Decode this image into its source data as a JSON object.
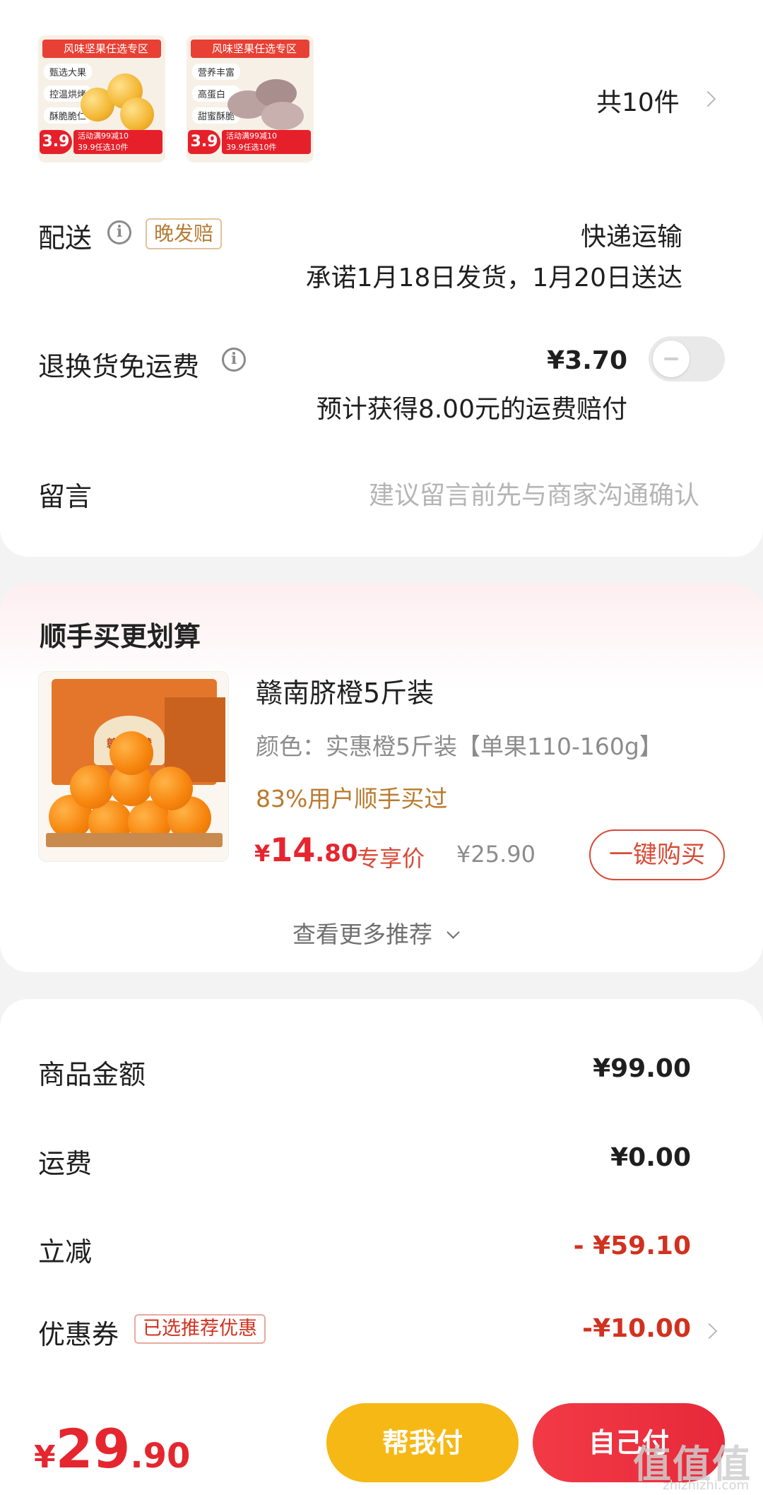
{
  "order": {
    "thumbs": [
      {
        "banner": "风味坚果任选专区",
        "tags": [
          "甄选大果",
          "控温烘烤",
          "酥脆脆仁"
        ],
        "price": "3.9",
        "promo_line1": "活动满99减10",
        "promo_line2": "39.9任选10件"
      },
      {
        "banner": "风味坚果任选专区",
        "tags": [
          "营养丰富",
          "高蛋白",
          "甜蜜酥脆"
        ],
        "price": "3.9",
        "promo_line1": "活动满99减10",
        "promo_line2": "39.9任选10件"
      }
    ],
    "item_count": "共10件",
    "delivery": {
      "label": "配送",
      "badge": "晚发赔",
      "method": "快递运输",
      "promise": "承诺1月18日发货，1月20日送达"
    },
    "return_shipping": {
      "label": "退换货免运费",
      "price": "¥3.70",
      "note": "预计获得8.00元的运费赔付",
      "enabled": false
    },
    "message": {
      "label": "留言",
      "placeholder": "建议留言前先与商家沟通确认"
    }
  },
  "upsell": {
    "title": "顺手买更划算",
    "product": {
      "image_text": "赣南脐橙",
      "name": "赣南脐橙5斤装",
      "spec": "颜色：实惠橙5斤装【单果110-160g】",
      "social_proof": "83%用户顺手买过",
      "price_symbol": "¥",
      "price_int": "14",
      "price_dec": ".80",
      "price_tag": "专享价",
      "original_price": "¥25.90",
      "buy_label": "一键购买"
    },
    "more_label": "查看更多推荐"
  },
  "summary": {
    "rows": [
      {
        "label": "商品金额",
        "value": "¥99.00"
      },
      {
        "label": "运费",
        "value": "¥0.00"
      },
      {
        "label": "立减",
        "value": "- ¥59.10"
      },
      {
        "label": "优惠券",
        "badge": "已选推荐优惠",
        "value": "-¥10.00"
      }
    ]
  },
  "footer": {
    "currency": "¥",
    "total_int": "29",
    "total_dec": ".90",
    "help_pay_label": "帮我付",
    "self_pay_label": "自己付",
    "watermark": "值值值",
    "watermark_sub": "zhizhizhi.com"
  },
  "colors": {
    "accent_red": "#e5262f",
    "discount_red": "#d0321f",
    "gold": "#b97a2e",
    "help_pay_yellow": "#f6b814",
    "self_pay_red": "#ee2f3e"
  }
}
